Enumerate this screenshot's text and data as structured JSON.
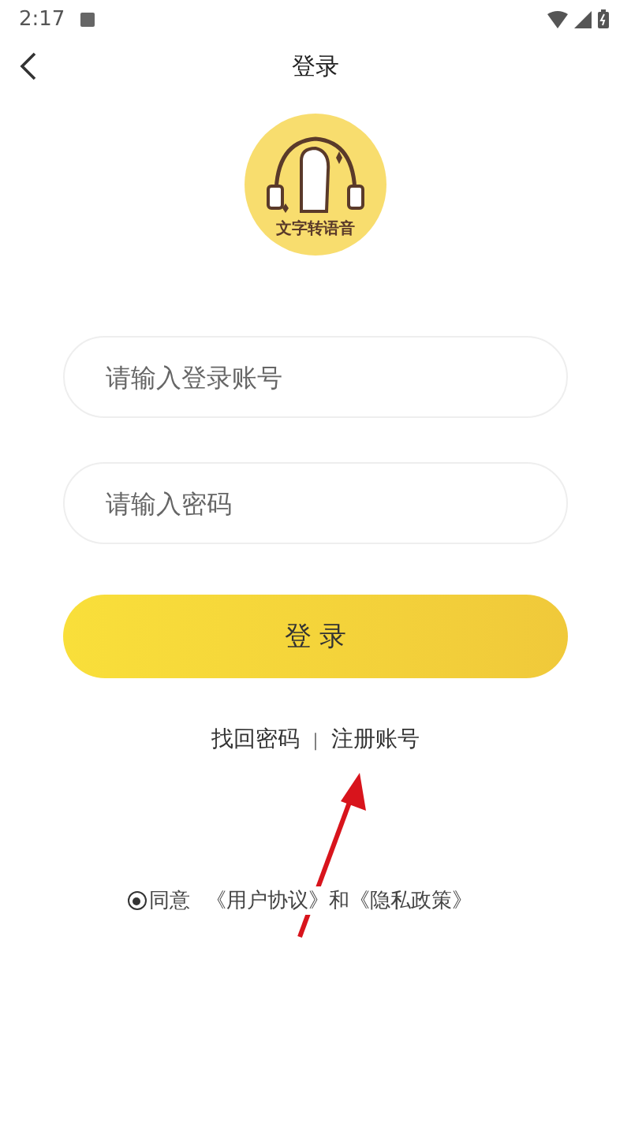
{
  "status_bar": {
    "time": "2:17"
  },
  "header": {
    "title": "登录"
  },
  "logo": {
    "text": "文字转语音"
  },
  "fields": [
    {
      "placeholder": "请输入登录账号"
    },
    {
      "placeholder": "请输入密码"
    }
  ],
  "login_button": {
    "label": "登 录"
  },
  "links": [
    {
      "label": "找回密码"
    },
    {
      "label": "注册账号"
    }
  ],
  "link_separator": "|",
  "agreement": {
    "checked": true,
    "parts": [
      {
        "text": "同意",
        "kind": "plain"
      },
      {
        "text": "《用户协议》",
        "kind": "link"
      },
      {
        "text": "和",
        "kind": "plain"
      },
      {
        "text": "《隐私政策》",
        "kind": "link"
      }
    ]
  }
}
